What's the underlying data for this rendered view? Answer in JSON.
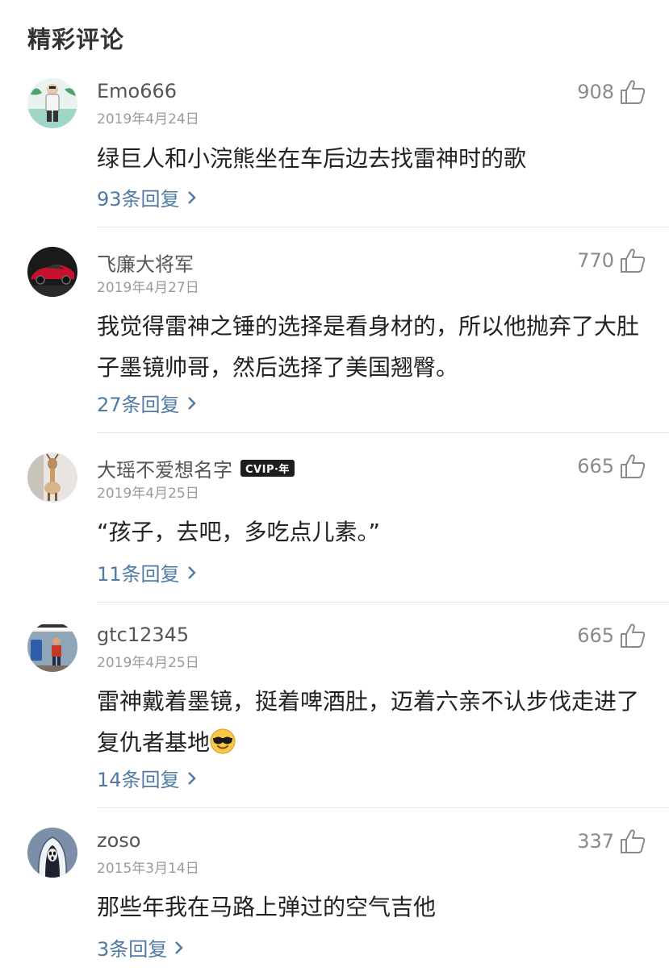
{
  "section_title": "精彩评论",
  "comments": [
    {
      "username": "Emo666",
      "badge": "",
      "date": "2019年4月24日",
      "likes": "908",
      "text": "绿巨人和小浣熊坐在车后边去找雷神时的歌",
      "replies": "93条回复",
      "avatar_icon": "old-man-cartoon-avatar"
    },
    {
      "username": "飞廉大将军",
      "badge": "",
      "date": "2019年4月27日",
      "likes": "770",
      "text": "我觉得雷神之锤的选择是看身材的，所以他抛弃了大肚子墨镜帅哥，然后选择了美国翘臀。",
      "replies": "27条回复",
      "avatar_icon": "red-sports-car-avatar"
    },
    {
      "username": "大瑶不爱想名字",
      "badge": "CVIP·年",
      "date": "2019年4月25日",
      "likes": "665",
      "text": "“孩子，去吧，多吃点儿素。”",
      "replies": "11条回复",
      "avatar_icon": "deer-figure-avatar"
    },
    {
      "username": "gtc12345",
      "badge": "",
      "date": "2019年4月25日",
      "likes": "665",
      "text": "雷神戴着墨镜，挺着啤酒肚，迈着六亲不认步伐走进了复仇者基地",
      "emoji": "sunglasses-emoji",
      "replies": "14条回复",
      "avatar_icon": "meme-photo-avatar"
    },
    {
      "username": "zoso",
      "badge": "",
      "date": "2015年3月14日",
      "likes": "337",
      "text": "那些年我在马路上弹过的空气吉他",
      "replies": "3条回复",
      "avatar_icon": "hooded-figure-avatar"
    }
  ],
  "icons": {
    "like": "thumbs-up-icon",
    "reply_arrow": "chevron-right-icon"
  },
  "colors": {
    "reply_link": "#4f7aa3",
    "date": "#9a9a9a",
    "like_count": "#8a8a8a"
  }
}
